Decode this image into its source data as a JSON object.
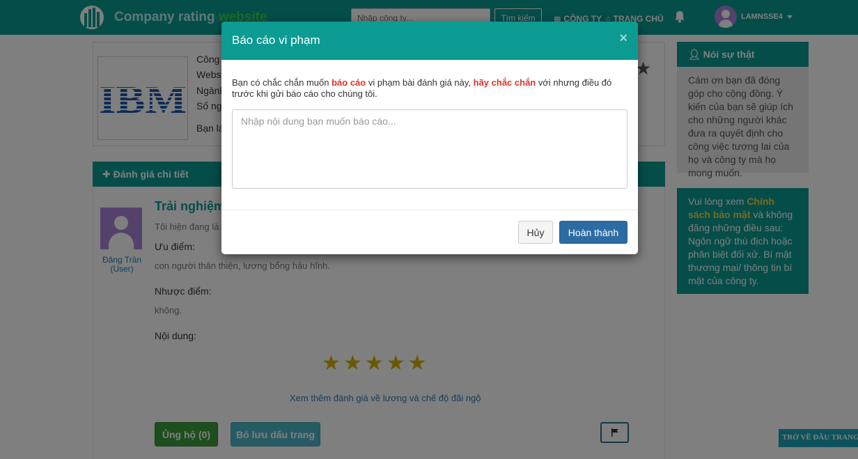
{
  "navbar": {
    "brand_main": "Company rating ",
    "brand_highlight": "website",
    "search_placeholder": "Nhập công ty...",
    "search_button": "Tìm kiếm",
    "link_company": "CÔNG TY",
    "link_home": "TRANG CHỦ",
    "username": "LAMNSSE4"
  },
  "company": {
    "logo_text": "IBM",
    "line1": "Công",
    "line2": "Websi",
    "line3": "Ngành",
    "line4": "Số ng",
    "line5": "Bạn là",
    "paren": ")"
  },
  "detail_header": "Đánh giá chi tiết",
  "review": {
    "reviewer_name": "Đăng Trần (User)",
    "title": "Trải nghiệm",
    "subtitle": "Tôi hiện đang là",
    "pros_label": "Ưu điểm:",
    "pros_text": "con người thân thiện, lương bổng hậu hĩnh.",
    "cons_label": "Nhược điểm:",
    "cons_text": "không.",
    "content_label": "Nội dung:",
    "rating": 5,
    "more_link": "Xem thêm đánh giá về lương và chế độ đãi ngộ",
    "support_button": "Ủng hộ (0)",
    "bookmark_button": "Bỏ lưu dấu trang"
  },
  "sidebar": {
    "truth_title": "Nói sự thật",
    "truth_body": "Cám ơn bạn đã đóng góp cho cộng đồng. Ý kiến của bạn sẽ giúp ích cho những người khác đưa ra quyết định cho công việc tương lai của họ và công ty mà họ mong muốn.",
    "policy_prefix": "Vui lòng xem ",
    "policy_link": "Chính sách bảo mật",
    "policy_suffix": " và không đăng những điều sau: Ngôn ngữ thù địch hoặc phân biệt đối xử. Bí mật thương mại/ thông tin bí mật của công ty."
  },
  "back_to_top": "TRỞ VỀ ĐẦU TRANG",
  "modal": {
    "title": "Báo cáo vi phạm",
    "close": "×",
    "desc_1": "Bạn có chắc chắn muốn ",
    "desc_red_1": "báo cáo",
    "desc_2": " vi phạm bài đánh giá này, ",
    "desc_red_2": "hãy chắc chắn",
    "desc_3": " với nhưng điều đó trước khi gửi báo cáo cho chúng tôi.",
    "textarea_placeholder": "Nhập nội dung bạn muốn báo cáo...",
    "cancel_button": "Hủy",
    "submit_button": "Hoàn thành"
  },
  "colors": {
    "primary": "#0b9b93",
    "star": "#d4b106",
    "danger_text": "#e0342a",
    "submit": "#2d6ca2"
  }
}
